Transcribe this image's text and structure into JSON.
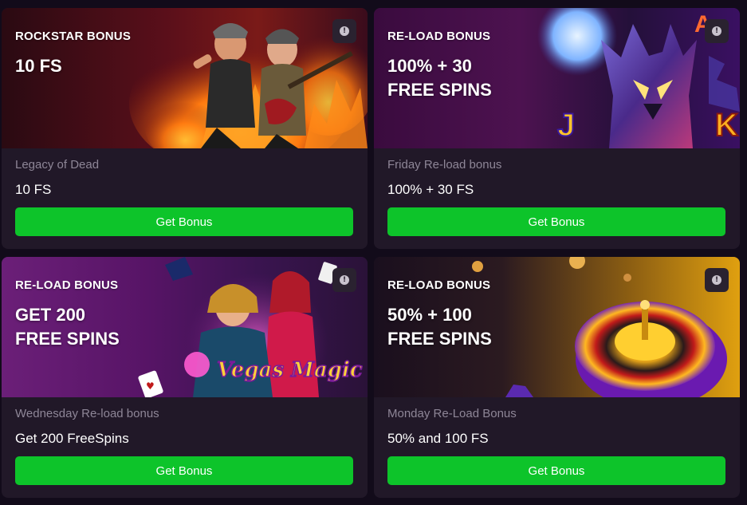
{
  "cards": [
    {
      "bonus_type": "ROCKSTAR BONUS",
      "headline": "10 FS",
      "game": "Legacy of Dead",
      "value": "10 FS",
      "button": "Get Bonus",
      "info_icon": "exclamation-icon",
      "banner_art": "rock-musicians-fire"
    },
    {
      "bonus_type": "RE-LOAD BONUS",
      "headline": "100% + 30\nFREE SPINS",
      "game": "Friday Re-load bonus",
      "value": "100% + 30 FS",
      "button": "Get Bonus",
      "info_icon": "exclamation-icon",
      "banner_art": "wolf-moon"
    },
    {
      "bonus_type": "RE-LOAD BONUS",
      "headline": "GET 200\nFREE SPINS",
      "game": "Wednesday Re-load bonus",
      "value": "Get 200 FreeSpins",
      "button": "Get Bonus",
      "info_icon": "exclamation-icon",
      "banner_art": "vegas-magic-magicians",
      "banner_logo": "Vegas Magic"
    },
    {
      "bonus_type": "RE-LOAD BONUS",
      "headline": "50% + 100\nFREE SPINS",
      "game": "Monday Re-Load Bonus",
      "value": "50% and 100 FS",
      "button": "Get Bonus",
      "info_icon": "exclamation-icon",
      "banner_art": "roulette-wheel"
    }
  ],
  "colors": {
    "page_bg": "#120b1a",
    "card_bg": "#211828",
    "button_green": "#0dc42a",
    "muted_text": "#8e8697"
  }
}
